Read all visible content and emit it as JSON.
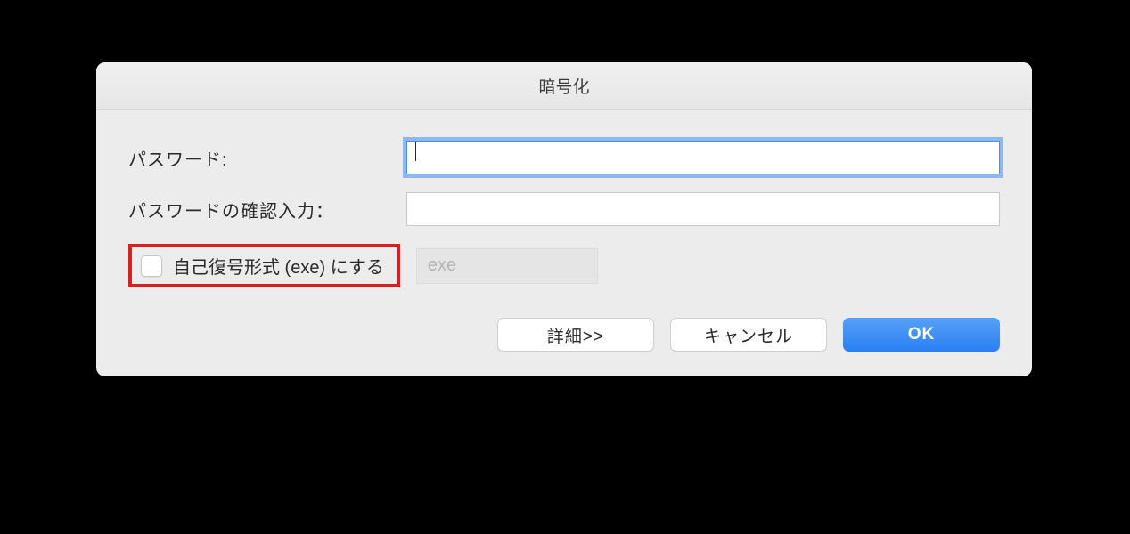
{
  "dialog": {
    "title": "暗号化",
    "fields": {
      "password_label": "パスワード:",
      "password_value": "",
      "confirm_label": "パスワードの確認入力：",
      "confirm_value": ""
    },
    "self_extract": {
      "checkbox_label": "自己復号形式 (exe) にする",
      "checked": false,
      "exe_placeholder": "exe"
    },
    "buttons": {
      "details": "詳細>>",
      "cancel": "キャンセル",
      "ok": "OK"
    }
  }
}
